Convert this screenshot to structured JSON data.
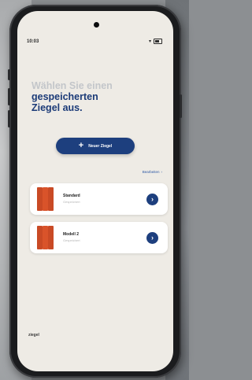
{
  "status_bar": {
    "time": "10:03",
    "wifi_icon": "wifi-icon",
    "battery_icon": "battery-icon"
  },
  "heading": {
    "line1": "Wählen Sie einen",
    "line2": "gespeicherten",
    "line3": "Ziegel aus."
  },
  "new_button": {
    "label": "Neuer Ziegel",
    "icon": "plus-icon"
  },
  "edit_link": {
    "label": "Bearbeiten",
    "icon": "chevron-right-icon"
  },
  "items": [
    {
      "name": "Standard",
      "subtitle": "Gespeichert",
      "icon": "roof-tile-icon"
    },
    {
      "name": "Modell 2",
      "subtitle": "Gespeichert",
      "icon": "roof-tile-icon"
    }
  ],
  "footer": {
    "brand": "ziegel"
  },
  "colors": {
    "accent": "#1d3f7e",
    "tile": "#d9532a",
    "screen_bg": "#eeebe5",
    "heading_light": "#c3c6ca",
    "heading_dark": "#1c3b78"
  }
}
